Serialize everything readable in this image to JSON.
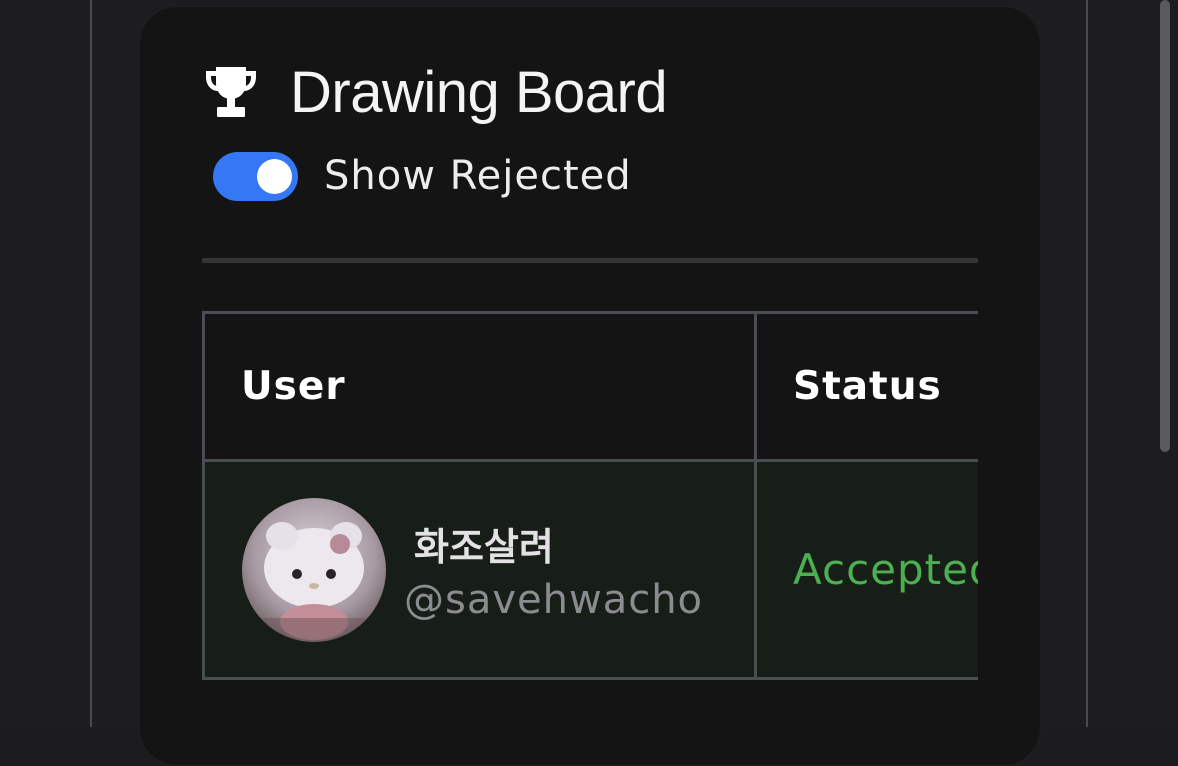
{
  "card": {
    "title": "Drawing Board",
    "title_icon": "trophy-icon",
    "toggle": {
      "label": "Show Rejected",
      "on": true,
      "color": "#3478f6"
    }
  },
  "table": {
    "headers": [
      "User",
      "Status"
    ],
    "rows": [
      {
        "display_name": "화조살려",
        "handle": "@savehwacho",
        "status": "Accepted",
        "status_color": "#4caf50"
      }
    ]
  }
}
